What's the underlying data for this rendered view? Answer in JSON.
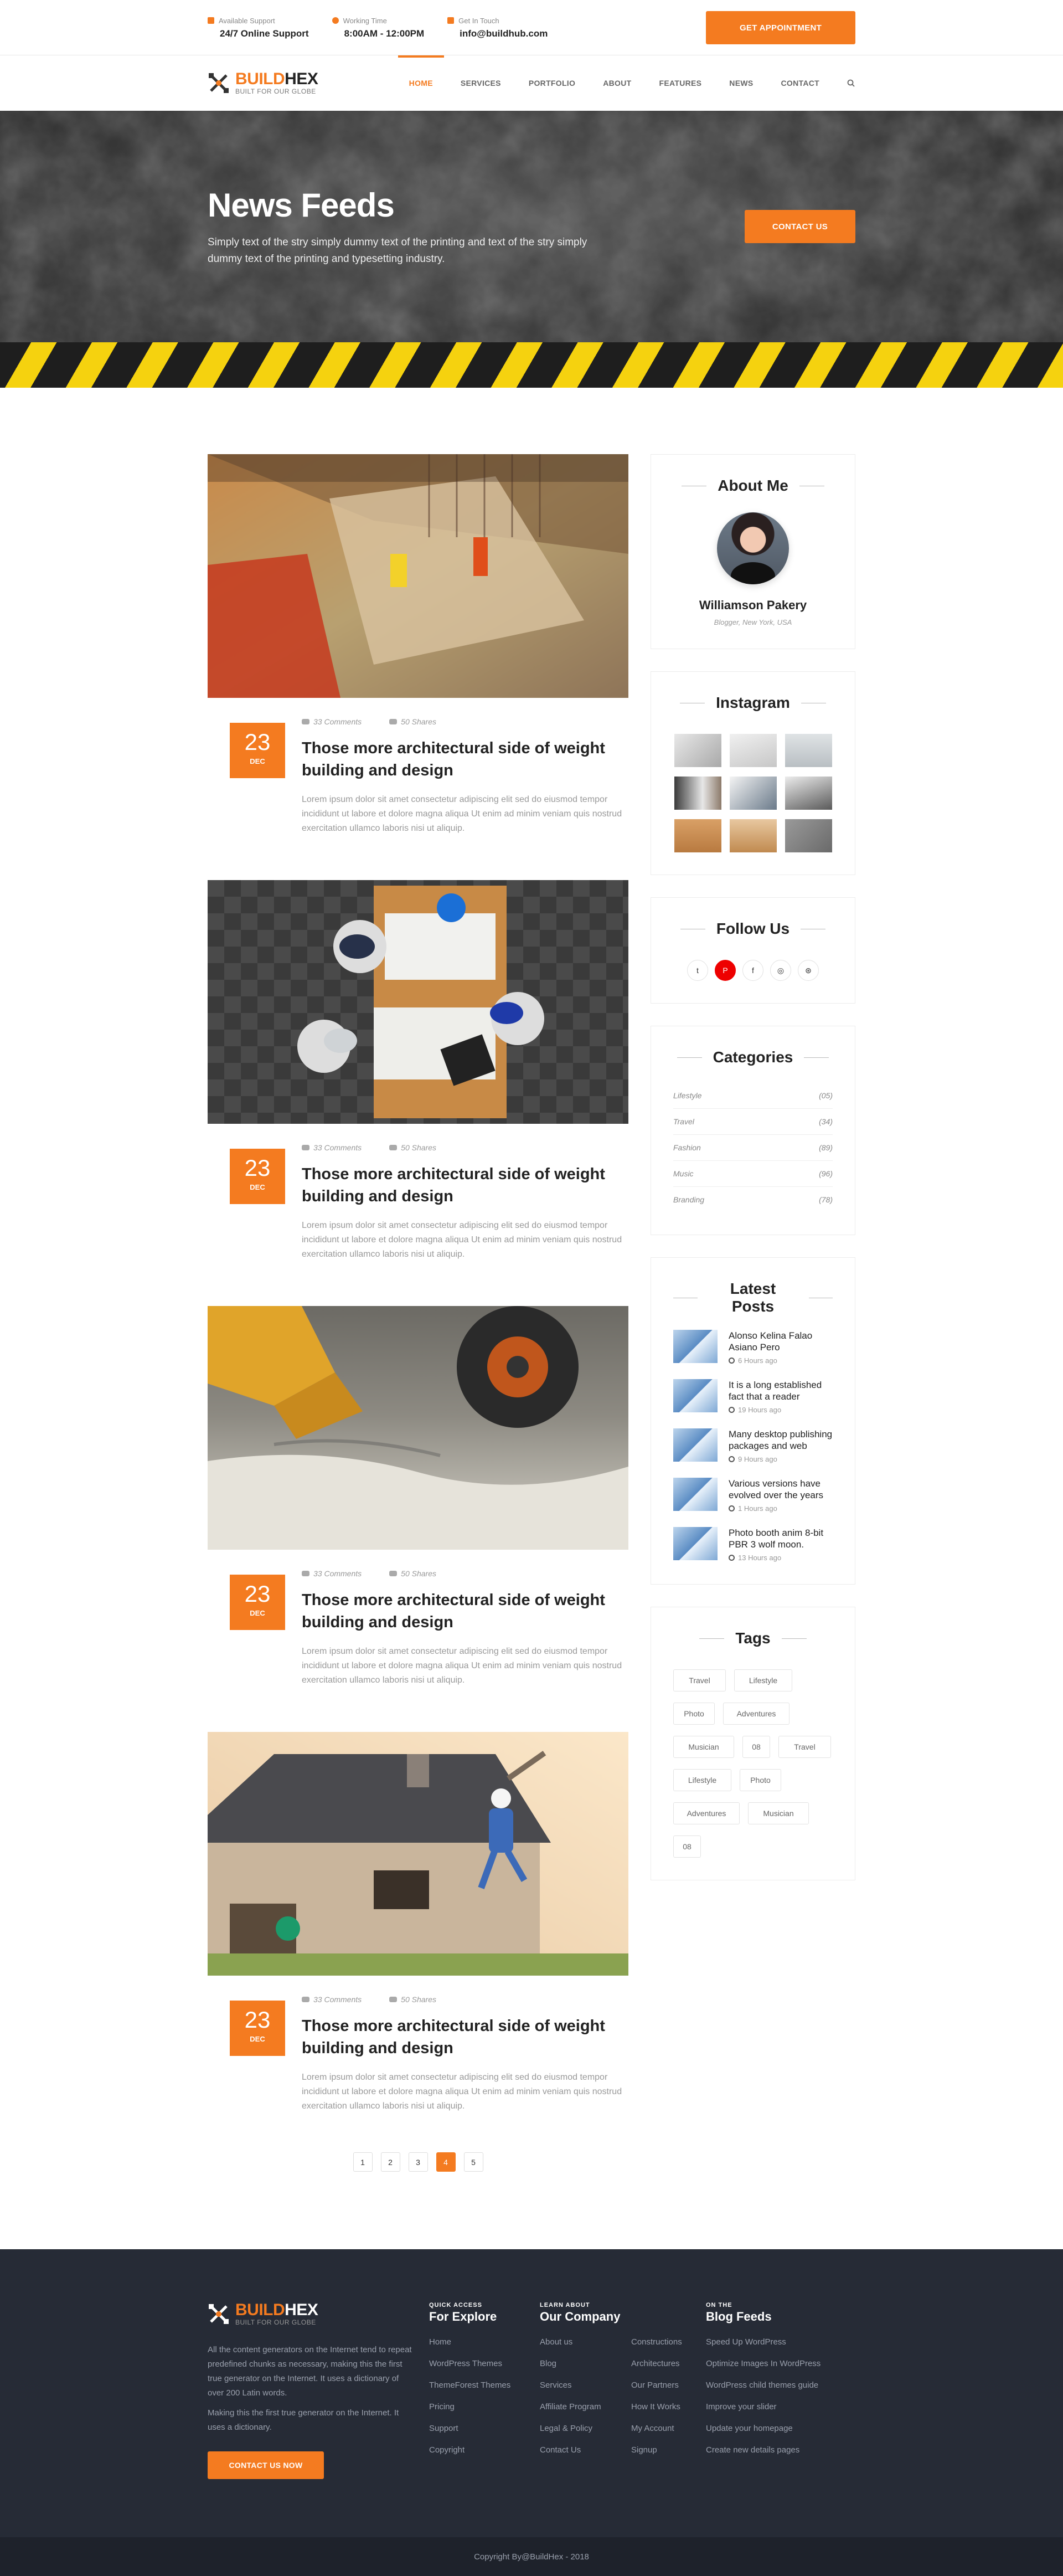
{
  "topbar": {
    "items": [
      {
        "label": "Available Support",
        "value": "24/7 Online Support"
      },
      {
        "label": "Working Time",
        "value": "8:00AM - 12:00PM"
      },
      {
        "label": "Get In Touch",
        "value": "info@buildhub.com"
      }
    ],
    "appointment": "Get Appointment"
  },
  "logo": {
    "part1": "BUILD",
    "part2": "HEX",
    "tagline": "BUILT FOR OUR GLOBE"
  },
  "nav": {
    "items": [
      "Home",
      "Services",
      "Portfolio",
      "About",
      "Features",
      "News",
      "Contact"
    ],
    "active": "Home"
  },
  "hero": {
    "title": "News Feeds",
    "text": "Simply text of the stry simply dummy text of the printing and text of the stry simply dummy text of the printing and typesetting industry.",
    "button": "Contact Us"
  },
  "posts": [
    {
      "day": "23",
      "month": "DEC",
      "comments": "33 Comments",
      "shares": "50 Shares",
      "title": "Those more architectural side of weight building and design",
      "excerpt": "Lorem ipsum dolor sit amet consectetur adipiscing elit sed do eiusmod tempor incididunt ut labore et dolore magna aliqua Ut enim ad minim veniam quis nostrud exercitation ullamco laboris nisi ut aliquip."
    },
    {
      "day": "23",
      "month": "DEC",
      "comments": "33 Comments",
      "shares": "50 Shares",
      "title": "Those more architectural side of weight building and design",
      "excerpt": "Lorem ipsum dolor sit amet consectetur adipiscing elit sed do eiusmod tempor incididunt ut labore et dolore magna aliqua Ut enim ad minim veniam quis nostrud exercitation ullamco laboris nisi ut aliquip."
    },
    {
      "day": "23",
      "month": "DEC",
      "comments": "33 Comments",
      "shares": "50 Shares",
      "title": "Those more architectural side of weight building and design",
      "excerpt": "Lorem ipsum dolor sit amet consectetur adipiscing elit sed do eiusmod tempor incididunt ut labore et dolore magna aliqua Ut enim ad minim veniam quis nostrud exercitation ullamco laboris nisi ut aliquip."
    },
    {
      "day": "23",
      "month": "DEC",
      "comments": "33 Comments",
      "shares": "50 Shares",
      "title": "Those more architectural side of weight building and design",
      "excerpt": "Lorem ipsum dolor sit amet consectetur adipiscing elit sed do eiusmod tempor incididunt ut labore et dolore magna aliqua Ut enim ad minim veniam quis nostrud exercitation ullamco laboris nisi ut aliquip."
    }
  ],
  "pagination": {
    "pages": [
      "1",
      "2",
      "3",
      "4",
      "5"
    ],
    "current": "4"
  },
  "sidebar": {
    "about": {
      "title": "About Me",
      "name": "Williamson Pakery",
      "sub": "Blogger, New York, USA"
    },
    "instagram": {
      "title": "Instagram"
    },
    "follow": {
      "title": "Follow Us",
      "icons": [
        "twitter-icon",
        "pinterest-icon",
        "facebook-icon",
        "instagram-icon",
        "dribbble-icon"
      ]
    },
    "categories": {
      "title": "Categories",
      "items": [
        {
          "name": "Lifestyle",
          "count": "(05)"
        },
        {
          "name": "Travel",
          "count": "(34)"
        },
        {
          "name": "Fashion",
          "count": "(89)"
        },
        {
          "name": "Music",
          "count": "(96)"
        },
        {
          "name": "Branding",
          "count": "(78)"
        }
      ]
    },
    "latest": {
      "title": "Latest Posts",
      "items": [
        {
          "title": "Alonso Kelina Falao Asiano Pero",
          "time": "6 Hours ago"
        },
        {
          "title": "It is a long established fact that a reader",
          "time": "19 Hours ago"
        },
        {
          "title": "Many desktop publishing packages and web",
          "time": "9 Hours ago"
        },
        {
          "title": "Various versions have evolved over the years",
          "time": "1 Hours ago"
        },
        {
          "title": "Photo booth anim 8-bit PBR 3 wolf moon.",
          "time": "13 Hours ago"
        }
      ]
    },
    "tags": {
      "title": "Tags",
      "items": [
        "Travel",
        "Lifestyle",
        "Photo",
        "Adventures",
        "Musician",
        "08",
        "Travel",
        "Lifestyle",
        "Photo",
        "Adventures",
        "Musician",
        "08"
      ]
    }
  },
  "footer": {
    "about": [
      "All the content generators on the Internet tend to repeat predefined chunks as necessary, making this the first true generator on the Internet. It uses a dictionary of over 200 Latin words.",
      "Making this the first true generator on the Internet. It uses a dictionary."
    ],
    "button": "Contact Us Now",
    "explore": {
      "small": "Quick Access",
      "title": "For Explore",
      "links": [
        "Home",
        "WordPress Themes",
        "ThemeForest Themes",
        "Pricing",
        "Support",
        "Copyright"
      ]
    },
    "company": {
      "small": "Learn About",
      "title": "Our Company",
      "links1": [
        "About us",
        "Blog",
        "Services",
        "Affiliate Program",
        "Legal & Policy",
        "Contact Us"
      ],
      "links2": [
        "Constructions",
        "Architectures",
        "Our Partners",
        "How It Works",
        "My Account",
        "Signup"
      ]
    },
    "blog": {
      "small": "On The",
      "title": "Blog Feeds",
      "links": [
        "Speed Up WordPress",
        "Optimize Images In WordPress",
        "WordPress child themes guide",
        "Improve your slider",
        "Update your homepage",
        "Create new details pages"
      ]
    },
    "copyright": "Copyright By@BuildHex - 2018"
  },
  "colors": {
    "accent": "#f47b20",
    "footer_bg": "#262b36",
    "copy_bg": "#1e222b"
  }
}
